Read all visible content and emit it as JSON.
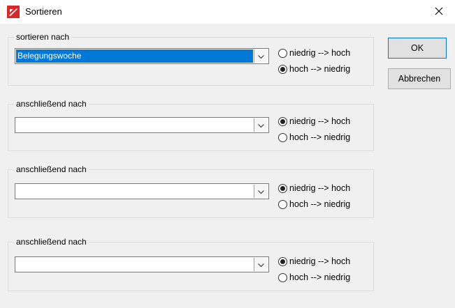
{
  "window": {
    "title": "Sortieren",
    "close_glyph": "✕"
  },
  "groups": [
    {
      "label": "sortieren nach",
      "combo_value": "Belegungswoche",
      "asc_label": "niedrig --> hoch",
      "desc_label": "hoch --> niedrig",
      "selected": "desc"
    },
    {
      "label": "anschließend nach",
      "combo_value": "",
      "asc_label": "niedrig --> hoch",
      "desc_label": "hoch --> niedrig",
      "selected": "asc"
    },
    {
      "label": "anschließend nach",
      "combo_value": "",
      "asc_label": "niedrig --> hoch",
      "desc_label": "hoch --> niedrig",
      "selected": "asc"
    },
    {
      "label": "anschließend nach",
      "combo_value": "",
      "asc_label": "niedrig --> hoch",
      "desc_label": "hoch --> niedrig",
      "selected": "asc"
    }
  ],
  "buttons": {
    "ok_label": "OK",
    "cancel_label": "Abbrechen"
  },
  "colors": {
    "selection": "#0078d7",
    "app_icon_red": "#d9262b"
  },
  "icons": {
    "app": "app-logo-icon",
    "close": "close-icon",
    "dropdown": "chevron-down-icon"
  }
}
